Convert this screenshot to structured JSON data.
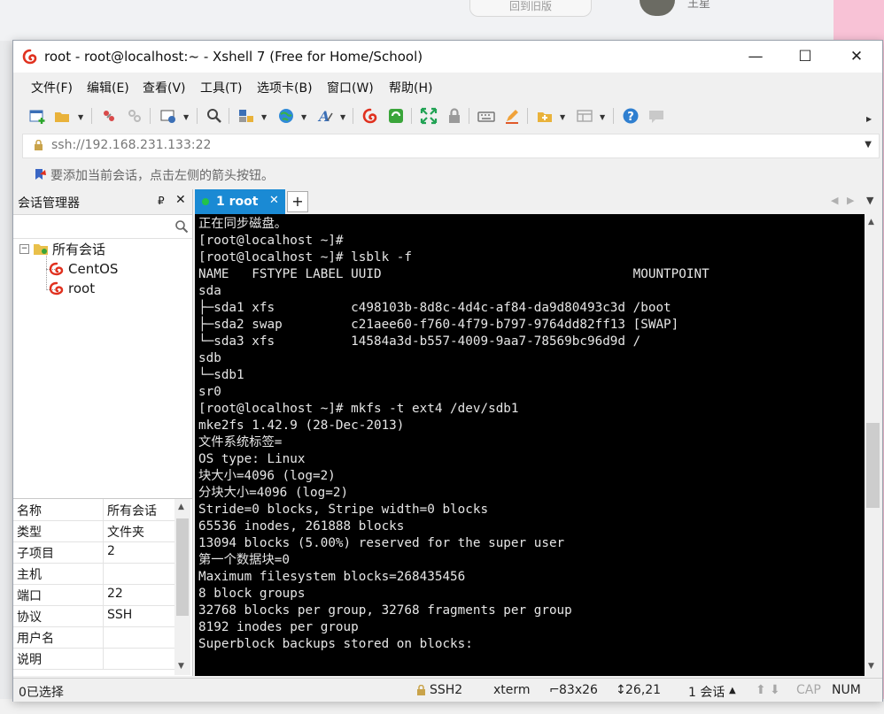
{
  "background": {
    "top_pill": "回到旧版",
    "user_name": "王星"
  },
  "window": {
    "title": "root - root@localhost:~ - Xshell 7 (Free for Home/School)",
    "minimize": "—",
    "maximize": "☐",
    "close": "✕"
  },
  "menu": [
    "文件(F)",
    "编辑(E)",
    "查看(V)",
    "工具(T)",
    "选项卡(B)",
    "窗口(W)",
    "帮助(H)"
  ],
  "address": {
    "url": "ssh://192.168.231.133:22"
  },
  "hint": {
    "text": "要添加当前会话，点击左侧的箭头按钮。"
  },
  "session_manager": {
    "title": "会话管理器",
    "pin": "₽",
    "close": "✕",
    "tree": {
      "root_label": "所有会话",
      "children": [
        "CentOS",
        "root"
      ]
    },
    "properties": [
      {
        "key": "名称",
        "value": "所有会话"
      },
      {
        "key": "类型",
        "value": "文件夹"
      },
      {
        "key": "子项目",
        "value": "2"
      },
      {
        "key": "主机",
        "value": ""
      },
      {
        "key": "端口",
        "value": "22"
      },
      {
        "key": "协议",
        "value": "SSH"
      },
      {
        "key": "用户名",
        "value": ""
      },
      {
        "key": "说明",
        "value": ""
      }
    ]
  },
  "tabs": {
    "active_label": "1 root",
    "add": "+",
    "nav_left": "◀",
    "nav_right": "▶"
  },
  "terminal": {
    "lines": [
      "正在同步磁盘。",
      "[root@localhost ~]#",
      "[root@localhost ~]# lsblk -f",
      "NAME   FSTYPE LABEL UUID                                 MOUNTPOINT",
      "sda",
      "├─sda1 xfs          c498103b-8d8c-4d4c-af84-da9d80493c3d /boot",
      "├─sda2 swap         c21aee60-f760-4f79-b797-9764dd82ff13 [SWAP]",
      "└─sda3 xfs          14584a3d-b557-4009-9aa7-78569bc96d9d /",
      "sdb",
      "└─sdb1",
      "sr0",
      "[root@localhost ~]# mkfs -t ext4 /dev/sdb1",
      "mke2fs 1.42.9 (28-Dec-2013)",
      "文件系统标签=",
      "OS type: Linux",
      "块大小=4096 (log=2)",
      "分块大小=4096 (log=2)",
      "Stride=0 blocks, Stripe width=0 blocks",
      "65536 inodes, 261888 blocks",
      "13094 blocks (5.00%) reserved for the super user",
      "第一个数据块=0",
      "Maximum filesystem blocks=268435456",
      "8 block groups",
      "32768 blocks per group, 32768 fragments per group",
      "8192 inodes per group",
      "Superblock backups stored on blocks:"
    ]
  },
  "status": {
    "selection": "0已选择",
    "protocol": "SSH2",
    "terminal_type": "xterm",
    "size": "83x26",
    "cursor": "26,21",
    "sessions": "1 会话",
    "cap": "CAP",
    "num": "NUM"
  }
}
